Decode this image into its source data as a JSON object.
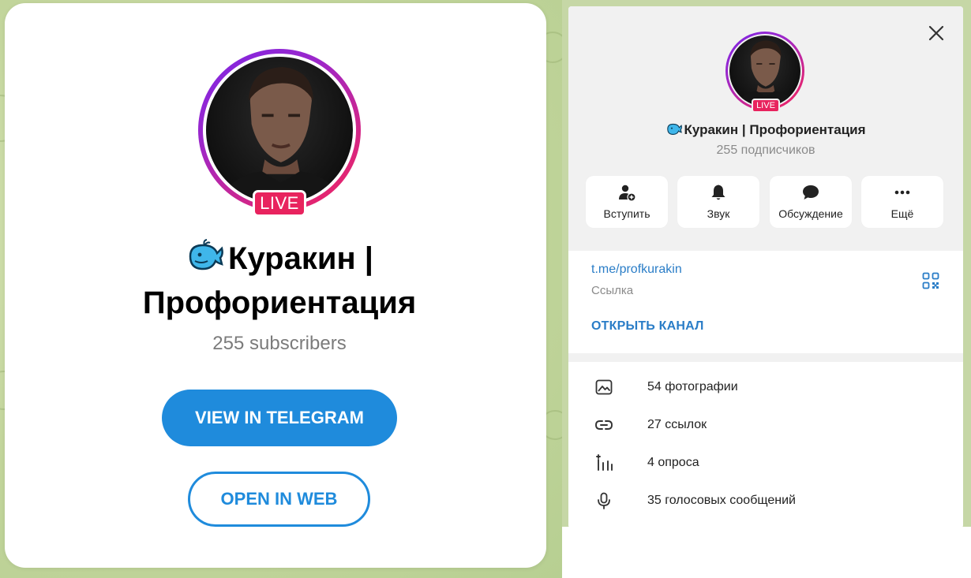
{
  "left": {
    "live_badge": "LIVE",
    "channel_title": "Куракин | Профориентация",
    "subscribers": "255 subscribers",
    "view_button": "VIEW IN TELEGRAM",
    "web_button": "OPEN IN WEB"
  },
  "right": {
    "live_badge": "LIVE",
    "channel_title": "Куракин | Профориентация",
    "subscribers": "255 подписчиков",
    "actions": [
      {
        "label": "Вступить",
        "icon": "add-user-icon"
      },
      {
        "label": "Звук",
        "icon": "bell-icon"
      },
      {
        "label": "Обсуждение",
        "icon": "chat-bubble-icon"
      },
      {
        "label": "Ещё",
        "icon": "more-dots-icon"
      }
    ],
    "link": "t.me/profkurakin",
    "link_caption": "Ссылка",
    "open_channel": "ОТКРЫТЬ КАНАЛ",
    "media": [
      {
        "label": "54 фотографии",
        "icon": "photo-icon"
      },
      {
        "label": "27 ссылок",
        "icon": "link-icon"
      },
      {
        "label": "4 опроса",
        "icon": "poll-icon"
      },
      {
        "label": "35 голосовых сообщений",
        "icon": "microphone-icon"
      }
    ]
  },
  "colors": {
    "accent_blue": "#1f8bdc",
    "link_blue": "#2a7dc7",
    "live_red": "#e8235e",
    "ring_purple": "#7b26e6",
    "whale_blue": "#3fb6ea"
  }
}
